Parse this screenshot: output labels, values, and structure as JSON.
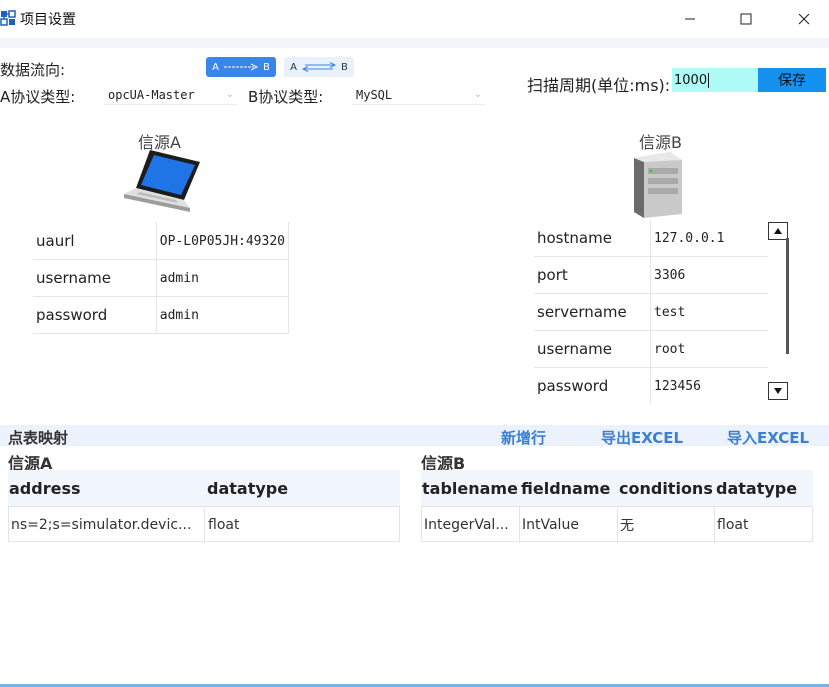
{
  "window": {
    "title": "项目设置",
    "minimize_glyph": "—",
    "maximize_glyph": "☐",
    "close_glyph": "✕"
  },
  "direction": {
    "label": "数据流向:",
    "btn_a_to_b": {
      "left": "A",
      "right": "B"
    },
    "btn_bidir": {
      "left": "A",
      "right": "B"
    }
  },
  "protocol": {
    "a_label": "A协议类型:",
    "a_value": "opcUA-Master",
    "b_label": "B协议类型:",
    "b_value": "MySQL"
  },
  "scan": {
    "label": "扫描周期(单位:ms):",
    "value": "1000",
    "save_label": "保存"
  },
  "source_a": {
    "title": "信源A",
    "fields": [
      {
        "key": "uaurl",
        "value": "OP-L0P05JH:49320"
      },
      {
        "key": "username",
        "value": "admin"
      },
      {
        "key": "password",
        "value": "admin"
      }
    ]
  },
  "source_b": {
    "title": "信源B",
    "fields": [
      {
        "key": "hostname",
        "value": "127.0.0.1"
      },
      {
        "key": "port",
        "value": "3306"
      },
      {
        "key": "servername",
        "value": "test"
      },
      {
        "key": "username",
        "value": "root"
      },
      {
        "key": "password",
        "value": "123456"
      }
    ]
  },
  "mapping": {
    "title": "点表映射",
    "add_row": "新增行",
    "export_excel": "导出EXCEL",
    "import_excel": "导入EXCEL",
    "grid_a": {
      "title": "信源A",
      "columns": [
        "address",
        "datatype"
      ],
      "rows": [
        [
          "ns=2;s=simulator.devic...",
          "float"
        ]
      ]
    },
    "grid_b": {
      "title": "信源B",
      "columns": [
        "tablename",
        "fieldname",
        "conditions",
        "datatype"
      ],
      "rows": [
        [
          "IntegerVal...",
          "IntValue",
          "无",
          "float"
        ]
      ]
    }
  },
  "colors": {
    "accent": "#1592f0",
    "period_input_bg": "#aefaf6",
    "link": "#3d7fd3",
    "header_bg": "#f1f6fc"
  }
}
